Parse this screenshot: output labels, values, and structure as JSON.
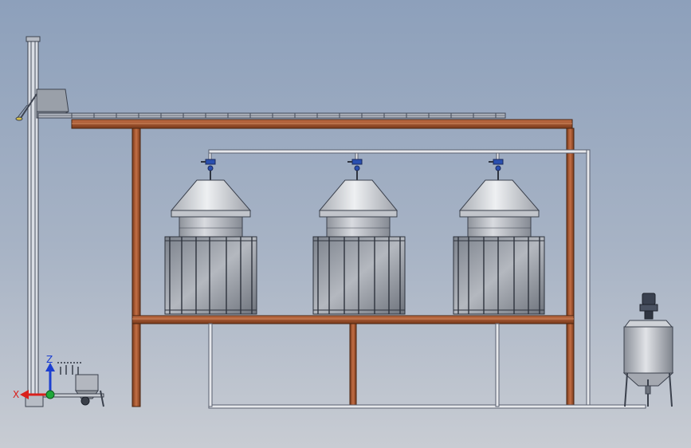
{
  "triad": {
    "x_label": "X",
    "z_label": "Z",
    "x_color": "#d9201c",
    "z_color": "#1c3fd0",
    "origin_color": "#1fa83a"
  },
  "colors": {
    "frame_steel": "#a45a35",
    "frame_steel_dark": "#6b3518",
    "pipe": "#e4e6ea",
    "tank_shell": "#c9ccd2",
    "cone_roof": "#d4d6da",
    "screen_mesh": "#9a9fa8",
    "conveyor": "#8f959f",
    "valve_blue": "#2a4fb0"
  },
  "components": [
    "bucket-elevator",
    "belt-conveyor",
    "steel-support-frame",
    "fermentation-tank-1",
    "fermentation-tank-2",
    "fermentation-tank-3",
    "transfer-piping",
    "mixing-tank-with-agitator",
    "feed-hopper"
  ]
}
